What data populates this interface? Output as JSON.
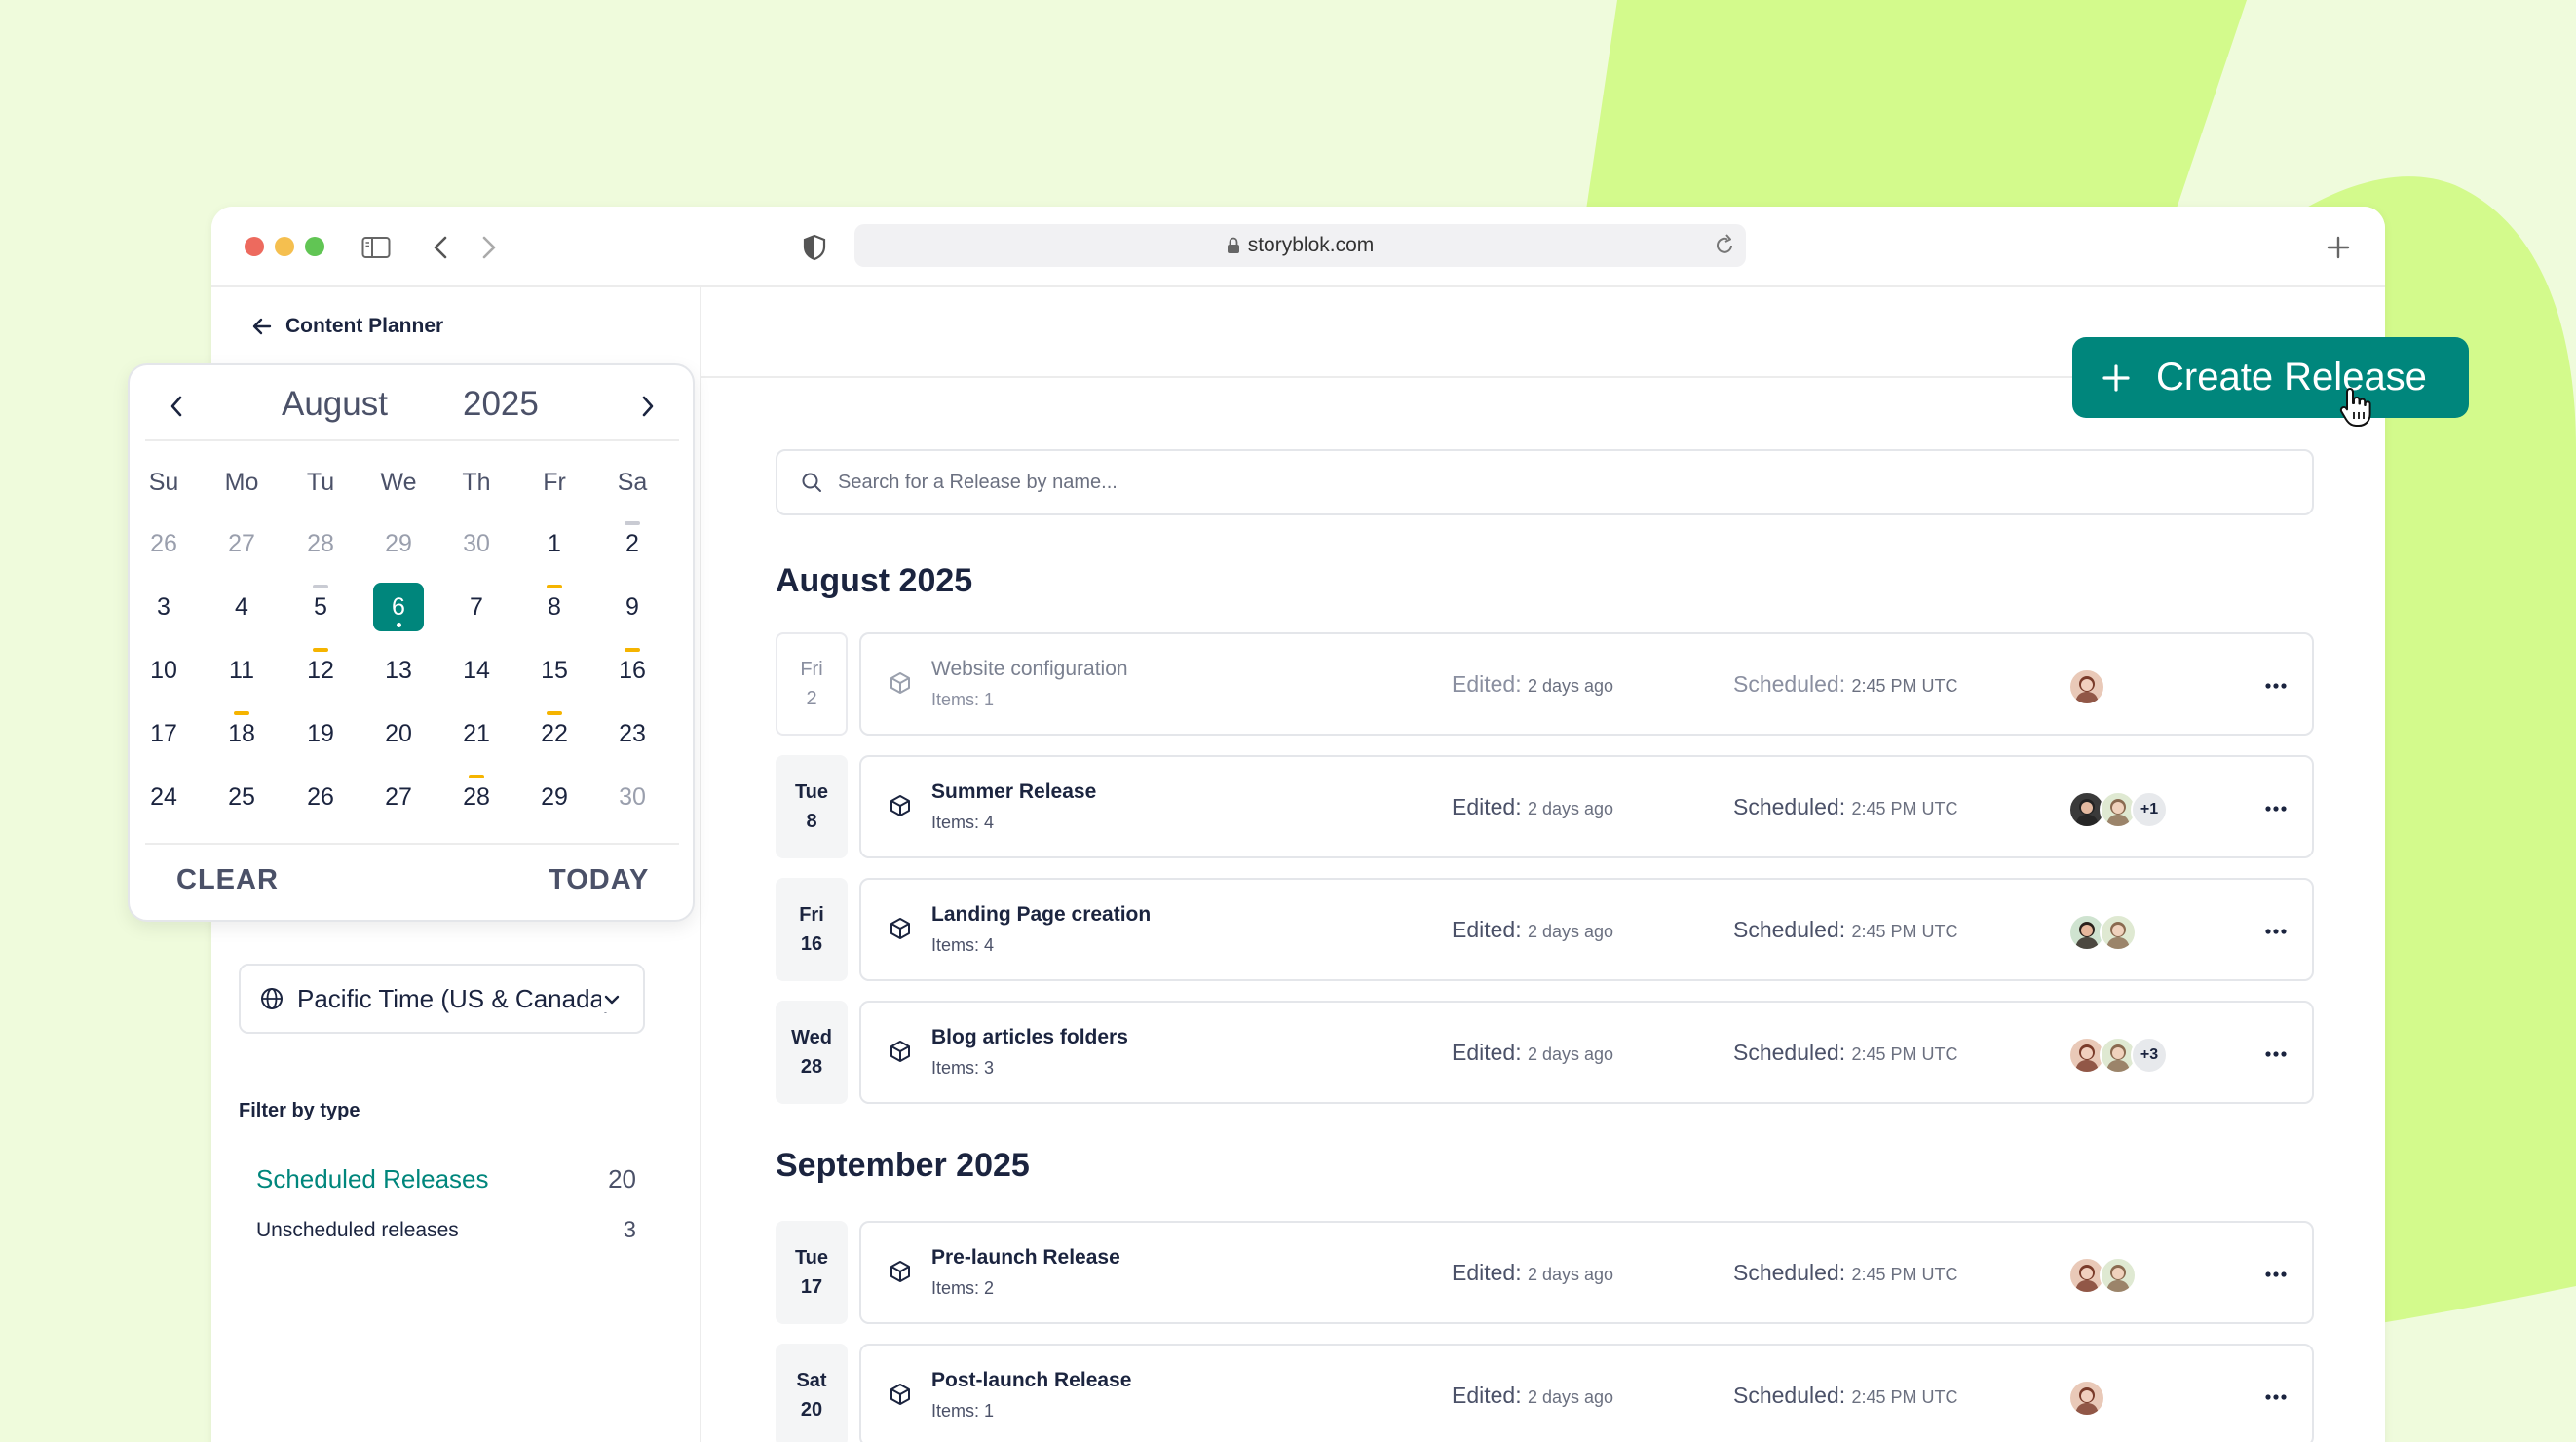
{
  "colors": {
    "accent": "#00867c",
    "background": "#effbdc",
    "shape": "#d3fa8c",
    "marker_orange": "#f5b400",
    "marker_gray": "#c9cbd3"
  },
  "browser": {
    "url": "storyblok.com"
  },
  "header": {
    "back_label": "Content Planner"
  },
  "create_button": {
    "label": "Create Release"
  },
  "search": {
    "placeholder": "Search for a Release by name..."
  },
  "calendar": {
    "month": "August",
    "year": "2025",
    "weekdays": [
      "Su",
      "Mo",
      "Tu",
      "We",
      "Th",
      "Fr",
      "Sa"
    ],
    "weeks": [
      [
        {
          "d": "26",
          "muted": true
        },
        {
          "d": "27",
          "muted": true
        },
        {
          "d": "28",
          "muted": true
        },
        {
          "d": "29",
          "muted": true
        },
        {
          "d": "30",
          "muted": true
        },
        {
          "d": "1"
        },
        {
          "d": "2",
          "mark": "gray"
        }
      ],
      [
        {
          "d": "3"
        },
        {
          "d": "4"
        },
        {
          "d": "5",
          "mark": "gray"
        },
        {
          "d": "6",
          "selected": true
        },
        {
          "d": "7"
        },
        {
          "d": "8",
          "mark": "orange"
        },
        {
          "d": "9"
        }
      ],
      [
        {
          "d": "10"
        },
        {
          "d": "11"
        },
        {
          "d": "12",
          "mark": "orange"
        },
        {
          "d": "13"
        },
        {
          "d": "14"
        },
        {
          "d": "15"
        },
        {
          "d": "16",
          "mark": "orange"
        }
      ],
      [
        {
          "d": "17"
        },
        {
          "d": "18",
          "mark": "orange"
        },
        {
          "d": "19"
        },
        {
          "d": "20"
        },
        {
          "d": "21"
        },
        {
          "d": "22",
          "mark": "orange"
        },
        {
          "d": "23"
        }
      ],
      [
        {
          "d": "24"
        },
        {
          "d": "25"
        },
        {
          "d": "26"
        },
        {
          "d": "27"
        },
        {
          "d": "28",
          "mark": "orange"
        },
        {
          "d": "29"
        },
        {
          "d": "30",
          "muted": true
        }
      ]
    ],
    "clear_label": "CLEAR",
    "today_label": "TODAY"
  },
  "timezone": {
    "value": "Pacific Time (US & Canada)"
  },
  "filter": {
    "title": "Filter by type",
    "items": [
      {
        "label": "Scheduled Releases",
        "count": "20",
        "active": true
      },
      {
        "label": "Unscheduled releases",
        "count": "3",
        "active": false
      }
    ]
  },
  "labels": {
    "edited": "Edited:",
    "scheduled": "Scheduled:"
  },
  "months": [
    {
      "heading": "August 2025"
    },
    {
      "heading": "September 2025"
    }
  ],
  "releases": [
    {
      "day": "Fri",
      "date": "2",
      "name": "Website configuration",
      "items": "Items: 1",
      "edited": "2 days ago",
      "scheduled": "2:45 PM UTC",
      "dim": true,
      "avatars": [
        "a1"
      ],
      "more": ""
    },
    {
      "day": "Tue",
      "date": "8",
      "name": "Summer Release",
      "items": "Items: 4",
      "edited": "2 days ago",
      "scheduled": "2:45 PM UTC",
      "avatars": [
        "a2",
        "a3"
      ],
      "more": "+1"
    },
    {
      "day": "Fri",
      "date": "16",
      "name": "Landing Page creation",
      "items": "Items: 4",
      "edited": "2 days ago",
      "scheduled": "2:45 PM UTC",
      "avatars": [
        "a4",
        "a3"
      ],
      "more": ""
    },
    {
      "day": "Wed",
      "date": "28",
      "name": "Blog articles folders",
      "items": "Items: 3",
      "edited": "2 days ago",
      "scheduled": "2:45 PM UTC",
      "avatars": [
        "a1",
        "a3"
      ],
      "more": "+3"
    },
    {
      "day": "Tue",
      "date": "17",
      "name": "Pre-launch Release",
      "items": "Items: 2",
      "edited": "2 days ago",
      "scheduled": "2:45 PM UTC",
      "avatars": [
        "a1",
        "a3"
      ],
      "more": ""
    },
    {
      "day": "Sat",
      "date": "20",
      "name": "Post-launch Release",
      "items": "Items: 1",
      "edited": "2 days ago",
      "scheduled": "2:45 PM UTC",
      "avatars": [
        "a1"
      ],
      "more": ""
    }
  ]
}
